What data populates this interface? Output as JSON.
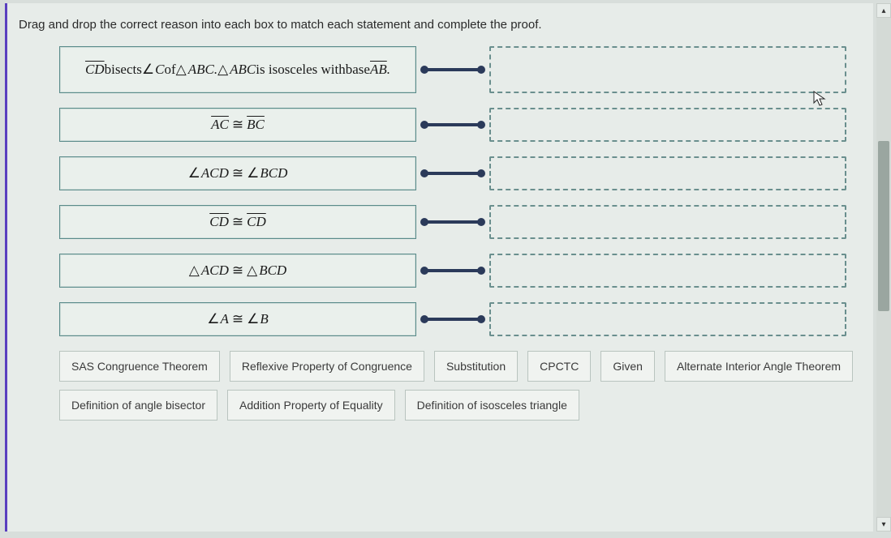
{
  "prompt": "Drag and drop the correct reason into each box to match each statement and complete the proof.",
  "statements": [
    {
      "html": "<span class='overline'>CD</span> <span class='upright'>bisects</span> <span class='ang'></span>C <span class='upright'>of</span> <span class='tri'></span> ABC. <span class='tri'></span> ABC <span class='upright'>is isosceles with</span><br><span class='upright'>base</span> <span class='overline'>AB</span>."
    },
    {
      "html": "<span class='overline'>AC</span> <span class='cong'>≅</span> <span class='overline'>BC</span>"
    },
    {
      "html": "<span class='ang'></span>ACD <span class='cong'>≅</span> <span class='ang'></span>BCD"
    },
    {
      "html": "<span class='overline'>CD</span> <span class='cong'>≅</span> <span class='overline'>CD</span>"
    },
    {
      "html": "<span class='tri'></span> ACD <span class='cong'>≅</span> <span class='tri'></span> BCD"
    },
    {
      "html": "<span class='ang'></span>A <span class='cong'>≅</span> <span class='ang'></span>B"
    }
  ],
  "choices": [
    "SAS Congruence Theorem",
    "Reflexive Property of Congruence",
    "Substitution",
    "CPCTC",
    "Given",
    "Alternate Interior Angle Theorem",
    "Definition of angle bisector",
    "Addition Property of Equality",
    "Definition of isosceles triangle"
  ],
  "scroll": {
    "up": "▴",
    "down": "▾"
  }
}
